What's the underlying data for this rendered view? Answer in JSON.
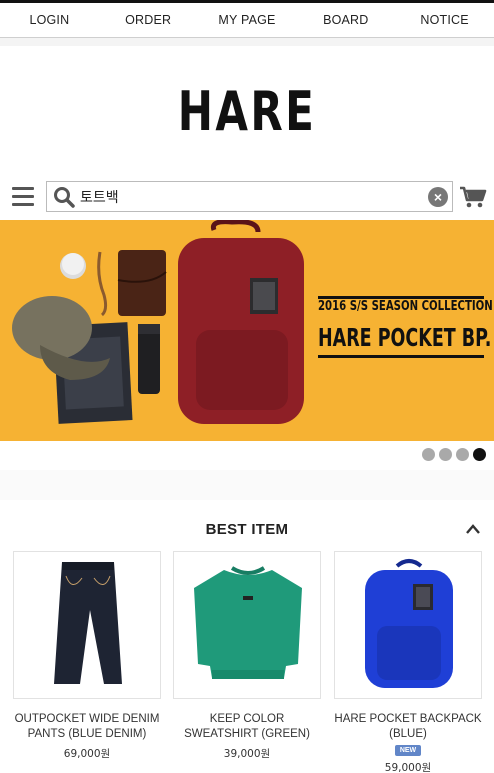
{
  "nav": {
    "items": [
      "LOGIN",
      "ORDER",
      "MY PAGE",
      "BOARD",
      "NOTICE"
    ]
  },
  "logo": {
    "text": "HARE"
  },
  "search": {
    "value": "토트백",
    "clear_glyph": "×"
  },
  "icons": {
    "menu": "hamburger-menu-icon",
    "search": "magnifier-icon",
    "clear": "clear-circle-icon",
    "cart": "shopping-cart-icon",
    "collapse": "chevron-up-icon"
  },
  "banner": {
    "line1": "2016 S/S SEASON COLLECTION",
    "line2": "HARE POCKET BP.",
    "slides": 4,
    "active_slide": 4,
    "background": "#f6b233"
  },
  "best": {
    "title": "BEST ITEM",
    "products": [
      {
        "name": "OUTPOCKET WIDE DENIM PANTS (BLUE DENIM)",
        "price": "69,000원",
        "badge": ""
      },
      {
        "name": "KEEP COLOR SWEATSHIRT (GREEN)",
        "price": "39,000원",
        "badge": ""
      },
      {
        "name": "HARE POCKET BACKPACK (BLUE)",
        "price": "59,000원",
        "badge": "NEW"
      }
    ]
  },
  "colors": {
    "accent_dark": "#111111",
    "badge_blue": "#6186c8",
    "sweatshirt_green": "#1f9a7a",
    "backpack_blue": "#1f3fd6",
    "backpack_red": "#8e1f26"
  }
}
